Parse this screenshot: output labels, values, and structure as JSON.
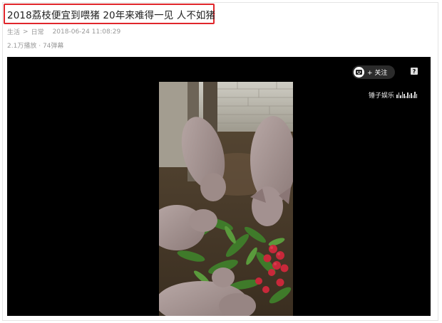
{
  "article": {
    "title": "2018荔枝便宜到喂猪 20年来难得一见 人不如猪",
    "breadcrumb": [
      "生活",
      "日常"
    ],
    "breadcrumb_separator": ">",
    "publish_time": "2018-06-24 11:08:29",
    "views": "2.1万播放",
    "stats_separator": "·",
    "danmaku": "74弹幕"
  },
  "player": {
    "follow_label": "+ 关注",
    "help_label": "?",
    "watermark": "锤子娱乐",
    "avatar_icon": "user-avatar-icon",
    "highlight_color": "#e0262b"
  }
}
